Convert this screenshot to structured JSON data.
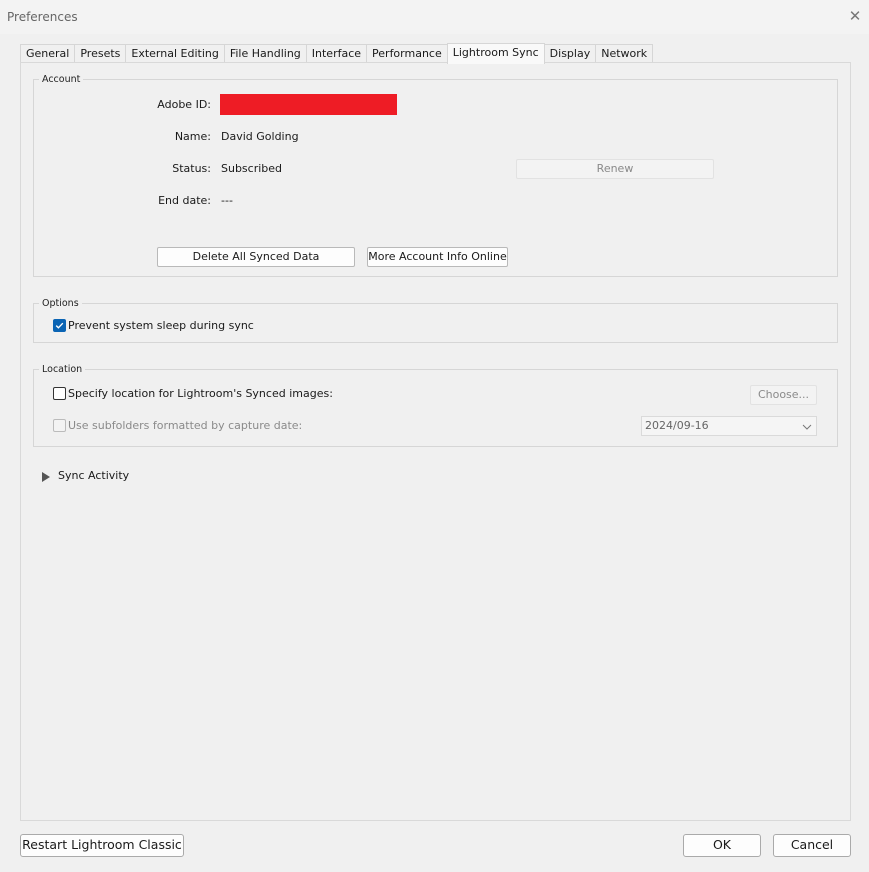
{
  "window": {
    "title": "Preferences",
    "close_glyph": "✕"
  },
  "tabs": [
    {
      "label": "General"
    },
    {
      "label": "Presets"
    },
    {
      "label": "External Editing"
    },
    {
      "label": "File Handling"
    },
    {
      "label": "Interface"
    },
    {
      "label": "Performance"
    },
    {
      "label": "Lightroom Sync",
      "active": true
    },
    {
      "label": "Display"
    },
    {
      "label": "Network"
    }
  ],
  "account": {
    "group_label": "Account",
    "adobe_id_label": "Adobe ID:",
    "name_label": "Name:",
    "name_value": "David Golding",
    "status_label": "Status:",
    "status_value": "Subscribed",
    "renew_label": "Renew",
    "end_date_label": "End date:",
    "end_date_value": "---",
    "delete_label": "Delete All Synced Data",
    "more_info_label": "More Account Info Online",
    "redaction_color": "#ee1c25"
  },
  "options": {
    "group_label": "Options",
    "prevent_sleep_label": "Prevent system sleep during sync",
    "prevent_sleep_checked": true
  },
  "location": {
    "group_label": "Location",
    "specify_label": "Specify location for Lightroom's Synced images:",
    "specify_checked": false,
    "choose_label": "Choose...",
    "subfolders_label": "Use subfolders formatted by capture date:",
    "subfolders_checked": false,
    "date_format_value": "2024/09-16"
  },
  "sync_activity": {
    "label": "Sync Activity",
    "expanded": false
  },
  "footer": {
    "restart_label": "Restart Lightroom Classic",
    "ok_label": "OK",
    "cancel_label": "Cancel"
  },
  "colors": {
    "accent": "#0a64b4",
    "background": "#f0f0f0"
  }
}
